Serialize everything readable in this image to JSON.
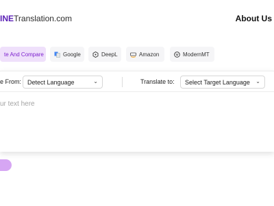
{
  "header": {
    "brand_highlight": "INE",
    "brand_rest": "Translation.com",
    "about_label": "About Us"
  },
  "tabs": [
    {
      "label": "te And Compare",
      "icon": "",
      "active": true
    },
    {
      "label": "Google",
      "icon": "google-translate-icon",
      "active": false
    },
    {
      "label": "DeepL",
      "icon": "deepl-icon",
      "active": false
    },
    {
      "label": "Amazon",
      "icon": "amazon-icon",
      "active": false
    },
    {
      "label": "ModernMT",
      "icon": "modernmt-icon",
      "active": false
    }
  ],
  "translate": {
    "from_label": "e From:",
    "from_value": "Detect Language",
    "to_label": "Translate to:",
    "to_value": "Select Target Language",
    "placeholder": "ur text here"
  },
  "colors": {
    "accent": "#7e22ce",
    "accent_bg": "#efe0fb",
    "pill": "#d6a6f3"
  }
}
